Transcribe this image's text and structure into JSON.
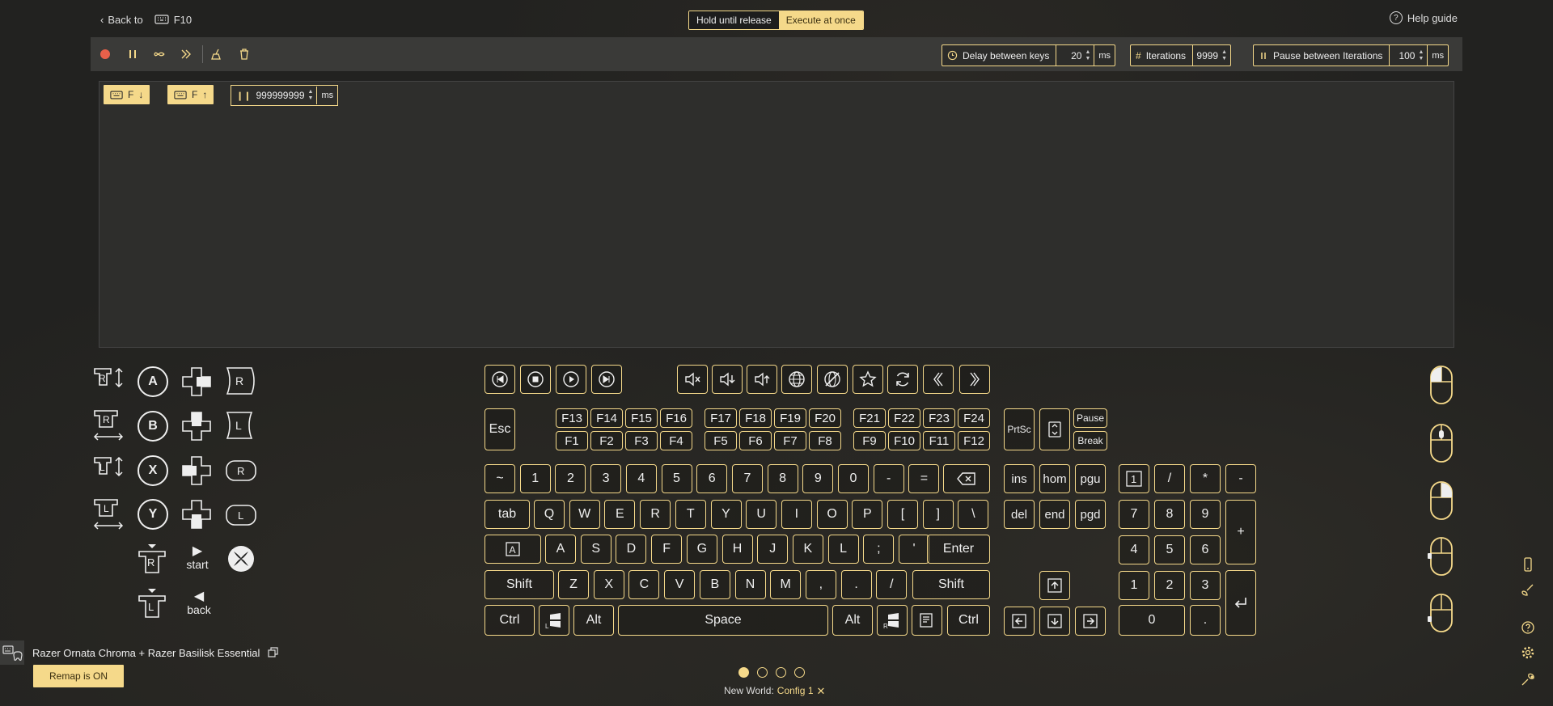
{
  "header": {
    "back_label": "Back to",
    "key_label": "F10",
    "help_label": "Help guide"
  },
  "mode": {
    "hold": "Hold until release",
    "exec": "Execute at once"
  },
  "toolbar": {
    "delay": {
      "label": "Delay between keys",
      "value": "20",
      "unit": "ms"
    },
    "iterations": {
      "label": "Iterations",
      "value": "9999"
    },
    "pause": {
      "label": "Pause between Iterations",
      "value": "100",
      "unit": "ms"
    }
  },
  "editor": {
    "chip1": "F",
    "chip2": "F",
    "delay_value": "999999999",
    "delay_unit": "ms"
  },
  "gamepad": {
    "btn_a": "A",
    "btn_b": "B",
    "btn_x": "X",
    "btn_y": "Y",
    "start": "start",
    "back": "back",
    "r": "R",
    "l": "L"
  },
  "keyboard": {
    "fn_top": [
      "F13",
      "F14",
      "F15",
      "F16",
      "F17",
      "F18",
      "F19",
      "F20",
      "F21",
      "F22",
      "F23",
      "F24"
    ],
    "fn_bot": [
      "F1",
      "F2",
      "F3",
      "F4",
      "F5",
      "F6",
      "F7",
      "F8",
      "F9",
      "F10",
      "F11",
      "F12"
    ],
    "esc": "Esc",
    "prtsc": "PrtSc",
    "pause": "Pause",
    "break": "Break",
    "row1": [
      "~",
      "1",
      "2",
      "3",
      "4",
      "5",
      "6",
      "7",
      "8",
      "9",
      "0",
      "-",
      "="
    ],
    "row2": [
      "tab",
      "Q",
      "W",
      "E",
      "R",
      "T",
      "Y",
      "U",
      "I",
      "O",
      "P",
      "[",
      "]",
      "\\"
    ],
    "row3": [
      "A",
      "S",
      "D",
      "F",
      "G",
      "H",
      "J",
      "K",
      "L",
      ";",
      "'"
    ],
    "enter": "Enter",
    "row4": [
      "Shift",
      "Z",
      "X",
      "C",
      "V",
      "B",
      "N",
      "M",
      ",",
      ".",
      "/",
      "Shift"
    ],
    "ctrl": "Ctrl",
    "alt": "Alt",
    "space": "Space",
    "nav": [
      "ins",
      "hom",
      "pgu",
      "del",
      "end",
      "pgd"
    ],
    "num_top": [
      "/",
      "*",
      "-"
    ],
    "num": [
      "7",
      "8",
      "9",
      "4",
      "5",
      "6",
      "1",
      "2",
      "3"
    ],
    "num_plus": "+",
    "num_zero": "0",
    "num_dot": ".",
    "num1": "1"
  },
  "footer": {
    "device": "Razer Ornata Chroma + Razer Basilisk Essential",
    "remap": "Remap is ON",
    "config_prefix": "New World:",
    "config_name": "Config 1"
  }
}
